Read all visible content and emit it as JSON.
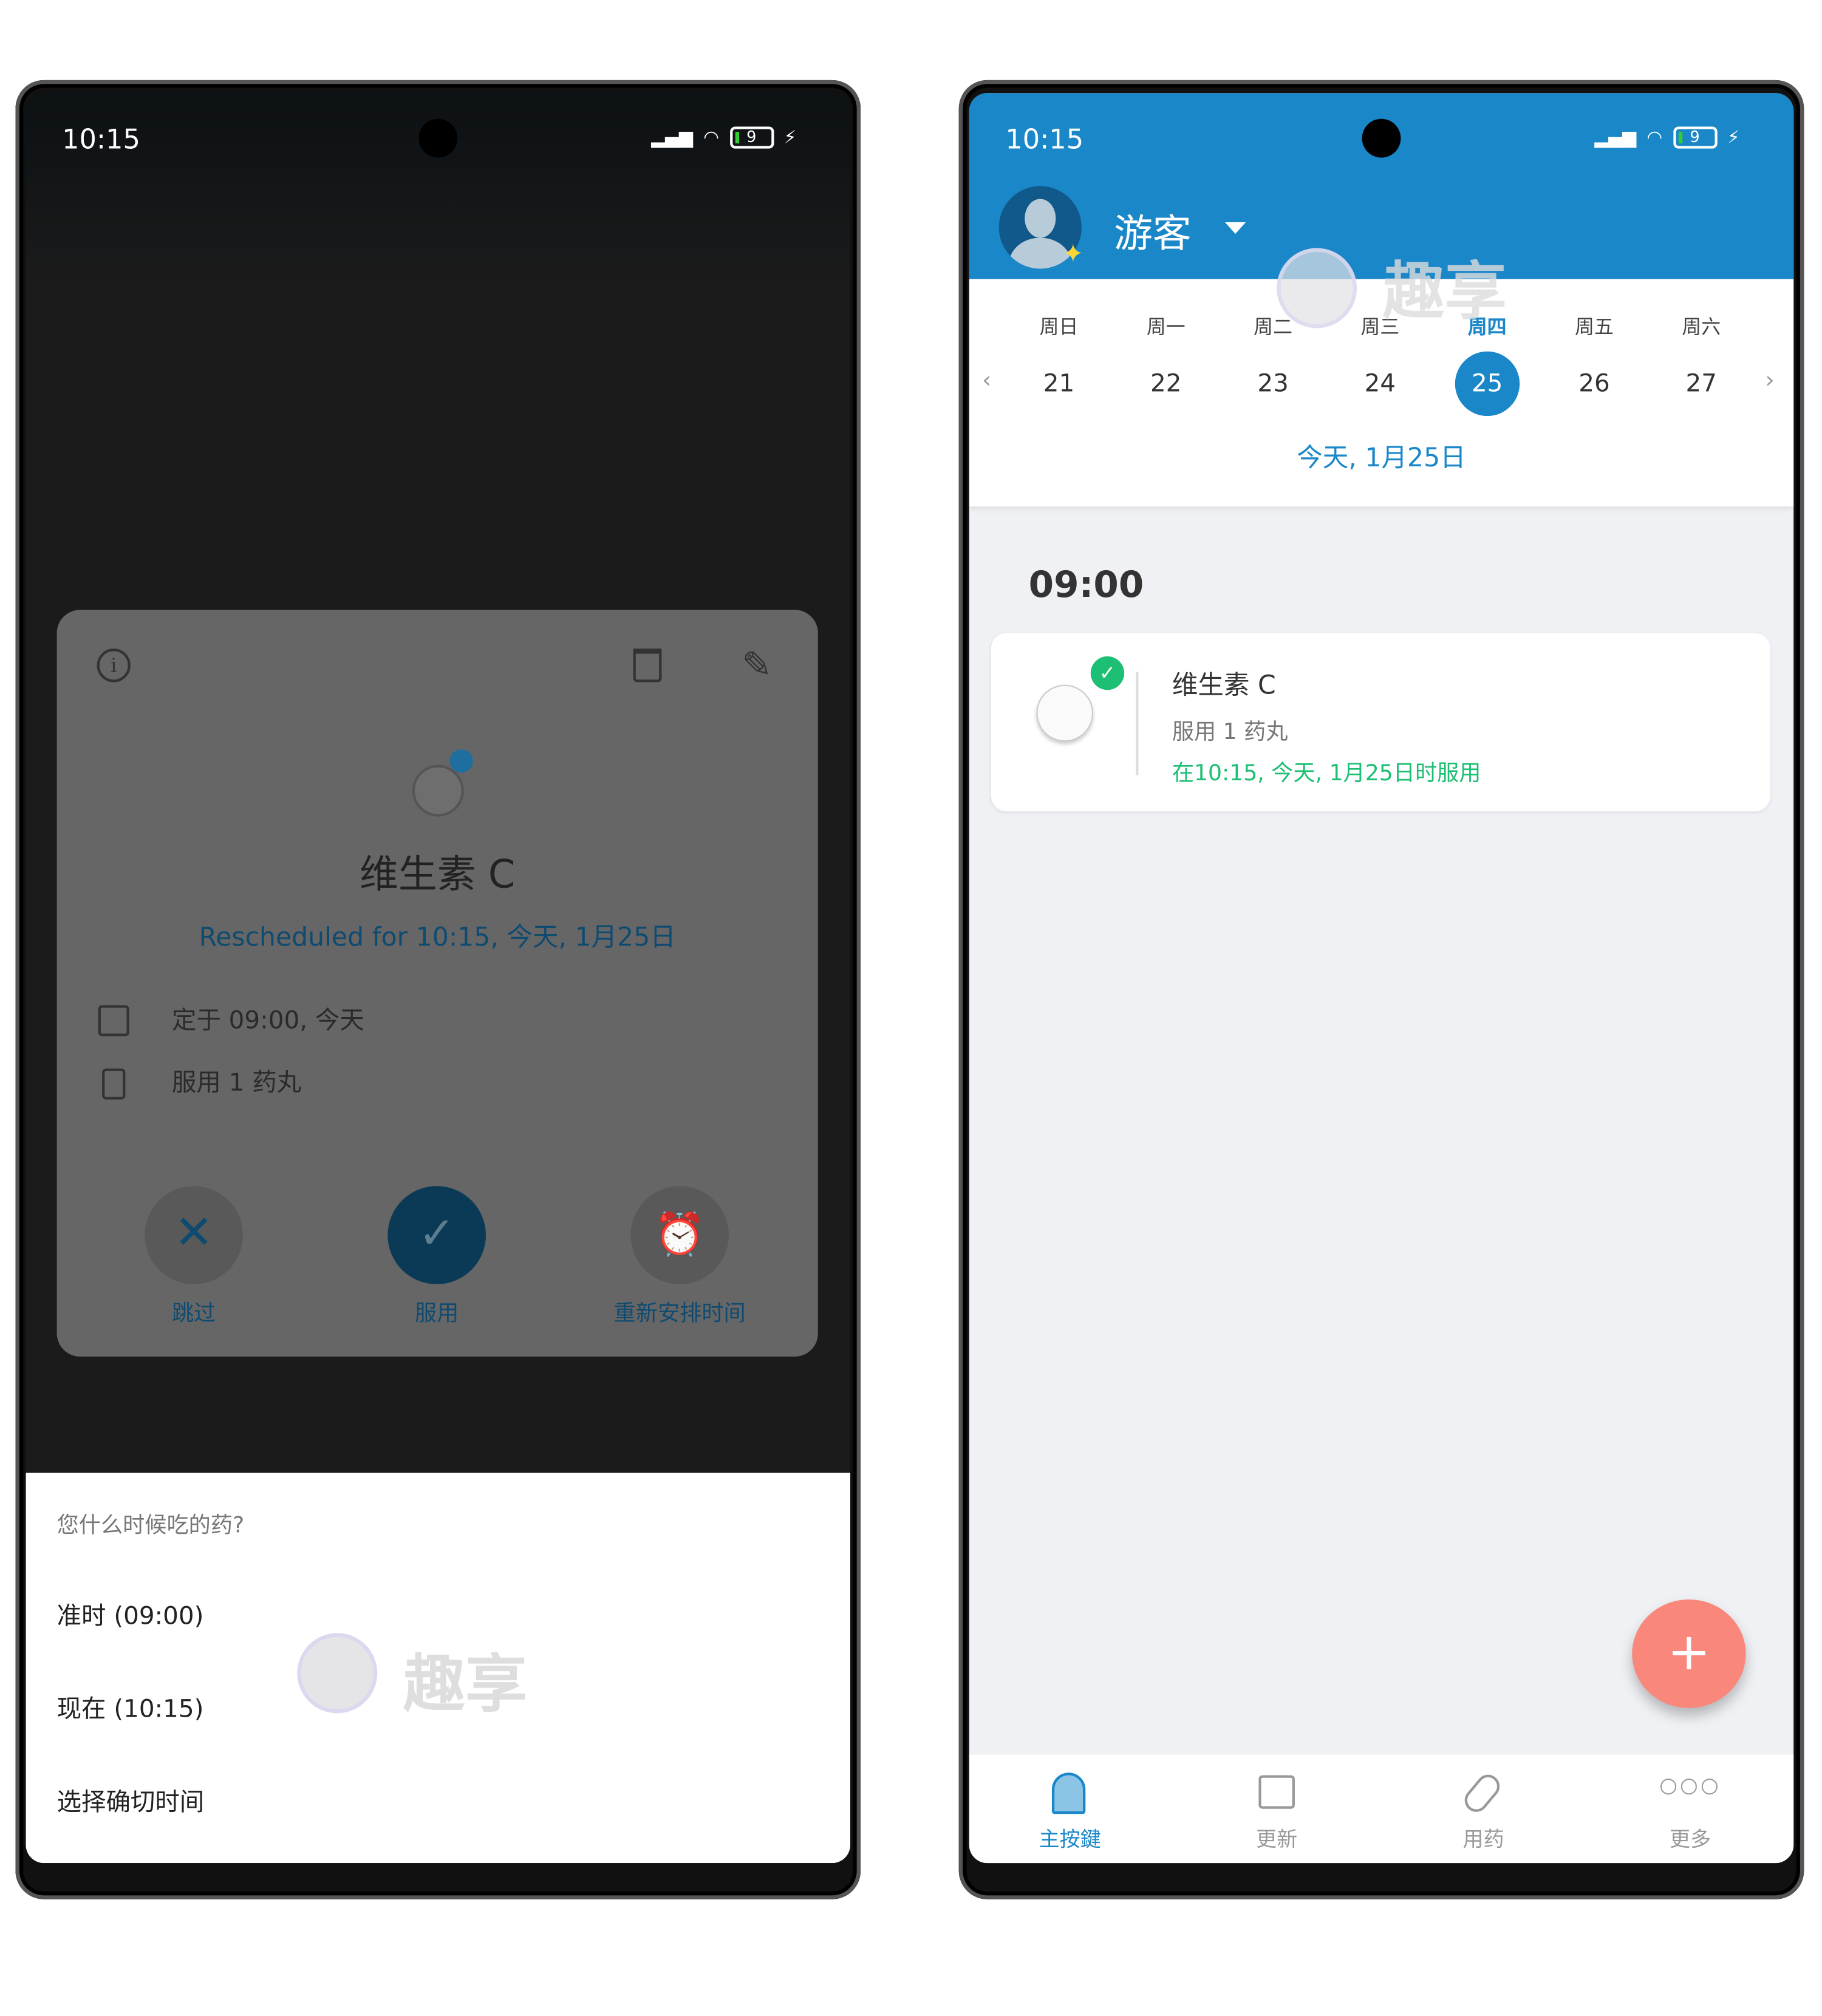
{
  "status": {
    "time": "10:15",
    "battery": "9",
    "signal": "HD"
  },
  "left": {
    "card": {
      "title": "维生素 C",
      "rescheduled": "Rescheduled for 10:15, 今天, 1月25日",
      "scheduled": "定于 09:00, 今天",
      "dose": "服用 1 药丸",
      "actions": [
        {
          "label": "跳过",
          "icon": "close-icon"
        },
        {
          "label": "服用",
          "icon": "check-icon"
        },
        {
          "label": "重新安排时间",
          "icon": "alarm-icon"
        }
      ]
    },
    "sheet": {
      "question": "您什么时候吃的药?",
      "options": [
        "准时 (09:00)",
        "现在 (10:15)",
        "选择确切时间"
      ]
    },
    "watermark": "趣享"
  },
  "right": {
    "user": "游客",
    "weekdays": [
      "周日",
      "周一",
      "周二",
      "周三",
      "周四",
      "周五",
      "周六"
    ],
    "dates": [
      "21",
      "22",
      "23",
      "24",
      "25",
      "26",
      "27"
    ],
    "selected_index": 4,
    "today_label": "今天, 1月25日",
    "slot_time": "09:00",
    "med": {
      "name": "维生素 C",
      "dose": "服用 1 药丸",
      "taken": "在10:15, 今天, 1月25日时服用"
    },
    "nav": [
      {
        "label": "主按鍵",
        "icon": "home-icon",
        "active": true
      },
      {
        "label": "更新",
        "icon": "news-icon"
      },
      {
        "label": "用药",
        "icon": "pill-icon"
      },
      {
        "label": "更多",
        "icon": "more-icon"
      }
    ],
    "watermark": "趣享"
  },
  "colors": {
    "header": "#1a87c9",
    "accent": "#1a87c9",
    "taken": "#1cbf73",
    "fab": "#fa877c",
    "take_button": "#0b3a56"
  }
}
